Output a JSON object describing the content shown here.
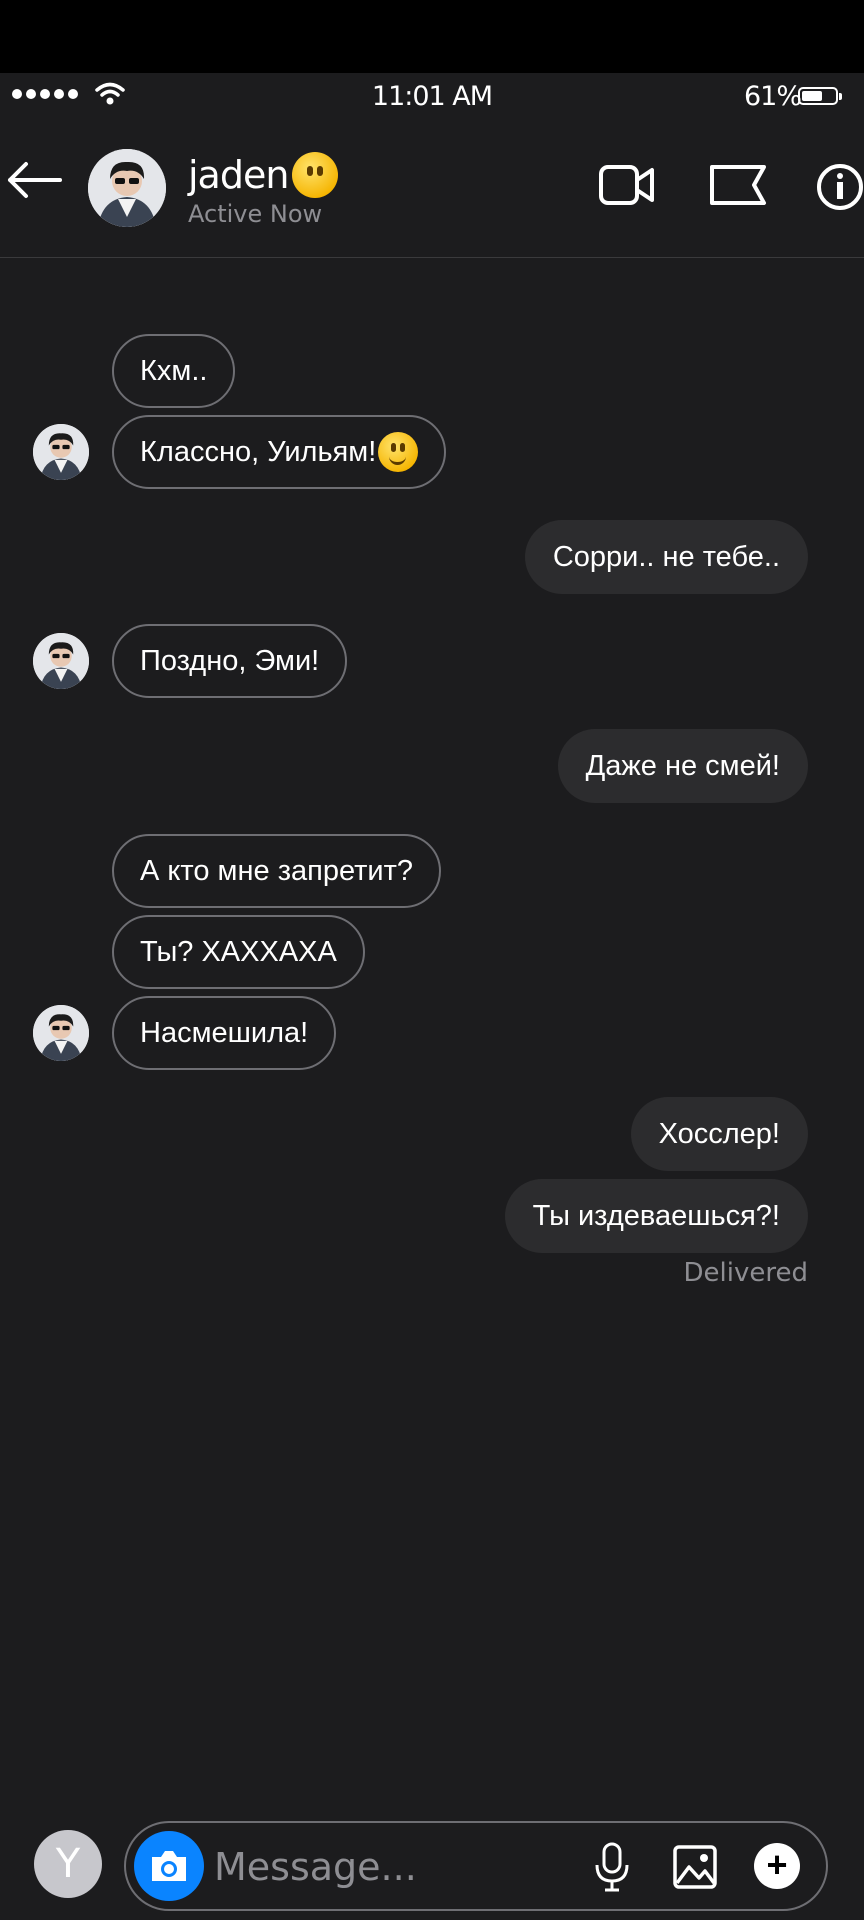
{
  "status_bar": {
    "time": "11:01 AM",
    "battery": "61%",
    "battery_level": 0.61
  },
  "header": {
    "name": "jaden",
    "status": "Active Now",
    "name_emoji": "neutral-face-emoji"
  },
  "messages": [
    {
      "side": "in",
      "text": "Кхм.."
    },
    {
      "side": "in",
      "text": "Классно, Уильям!",
      "emoji": "slightly-smiling-face-emoji"
    },
    {
      "side": "out",
      "text": "Сорри.. не тебе.."
    },
    {
      "side": "in",
      "text": "Поздно, Эми!"
    },
    {
      "side": "out",
      "text": "Даже не смей!"
    },
    {
      "side": "in",
      "text": "А кто мне запретит?"
    },
    {
      "side": "in",
      "text": "Ты? ХАХХАХА"
    },
    {
      "side": "in",
      "text": "Насмешила!"
    },
    {
      "side": "out",
      "text": "Хосслер!"
    },
    {
      "side": "out",
      "text": "Ты издеваешься?!"
    }
  ],
  "delivered": "Delivered",
  "composer": {
    "avatar_letter": "Y",
    "placeholder": "Message...",
    "plus": "+"
  },
  "colors": {
    "background": "#1c1c1e",
    "outgoing_bubble": "#2c2c2e",
    "accent": "#0a84ff"
  }
}
